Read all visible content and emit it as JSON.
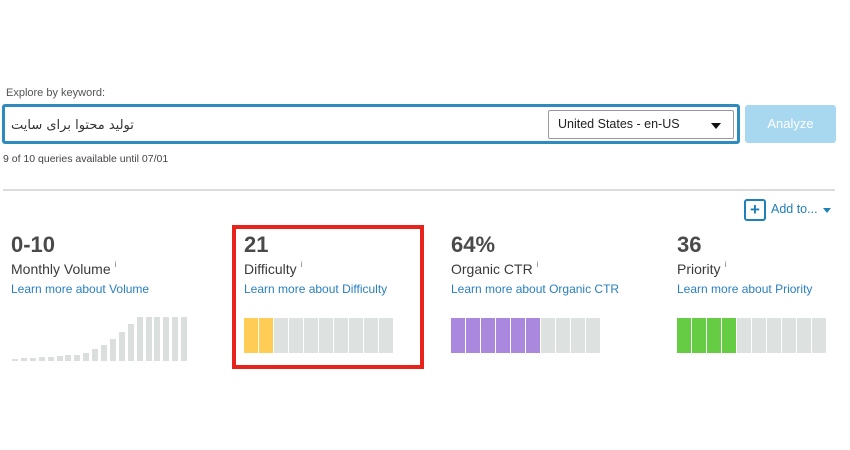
{
  "search": {
    "label": "Explore by keyword:",
    "value": "تولید محتوا برای سایت",
    "locale": "United States - en-US",
    "analyze_label": "Analyze",
    "queries_note": "9 of 10 queries available until 07/01"
  },
  "add_to": {
    "label": "Add to..."
  },
  "metrics": [
    {
      "value": "0-10",
      "name": "Monthly Volume",
      "info": "i",
      "learn": "Learn more about Volume"
    },
    {
      "value": "21",
      "name": "Difficulty",
      "info": "i",
      "learn": "Learn more about Difficulty",
      "filled_segments": 2,
      "total_segments": 10,
      "color": "#ffcc55"
    },
    {
      "value": "64%",
      "name": "Organic CTR",
      "info": "i",
      "learn": "Learn more about Organic CTR",
      "filled_segments": 6,
      "total_segments": 10,
      "color": "#aa88dd"
    },
    {
      "value": "36",
      "name": "Priority",
      "info": "i",
      "learn": "Learn more about Priority",
      "filled_segments": 4,
      "total_segments": 10,
      "color": "#66cc44"
    }
  ],
  "colors": {
    "accent": "#2e8bc0",
    "analyze_disabled": "#a8d7f0",
    "empty_segment": "#dde1e0",
    "highlight": "#e8231b"
  }
}
